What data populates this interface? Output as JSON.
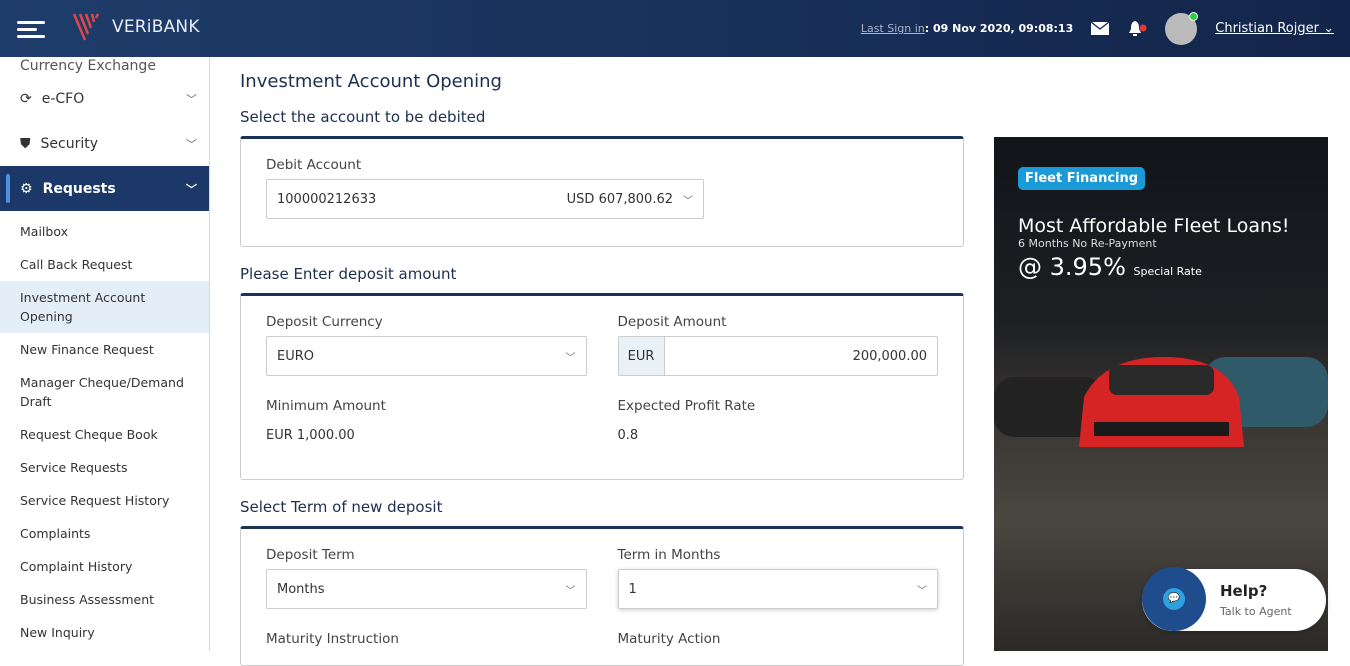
{
  "header": {
    "brand": "VERiBANK",
    "last_signin_label": "Last Sign in",
    "last_signin_value": ": 09 Nov 2020, 09:08:13",
    "user_name": "Christian Rojger"
  },
  "sidebar": {
    "cut_item": "Currency Exchange",
    "main": [
      {
        "label": "e-CFO"
      },
      {
        "label": "Security"
      },
      {
        "label": "Requests"
      }
    ],
    "sub": [
      "Mailbox",
      "Call Back Request",
      "Investment Account Opening",
      "New Finance Request",
      "Manager Cheque/Demand Draft",
      "Request Cheque Book",
      "Service Requests",
      "Service Request History",
      "Complaints",
      "Complaint History",
      "Business Assessment",
      "New Inquiry"
    ]
  },
  "main": {
    "title": "Investment Account Opening",
    "s1": {
      "heading": "Select the account to be debited",
      "debit_label": "Debit Account",
      "account": "100000212633",
      "balance": "USD 607,800.62"
    },
    "s2": {
      "heading": "Please Enter deposit amount",
      "currency_label": "Deposit Currency",
      "currency": "EURO",
      "amount_label": "Deposit Amount",
      "amount_prefix": "EUR",
      "amount": "200,000.00",
      "min_label": "Minimum Amount",
      "min_value": "EUR 1,000.00",
      "rate_label": "Expected Profit Rate",
      "rate_value": "0.8"
    },
    "s3": {
      "heading": "Select Term of new deposit",
      "term_label": "Deposit Term",
      "term": "Months",
      "months_label": "Term in Months",
      "months": "1",
      "maturity_instr_label": "Maturity Instruction",
      "maturity_action_label": "Maturity Action"
    }
  },
  "ad": {
    "badge": "Fleet Financing",
    "title": "Most Affordable Fleet Loans!",
    "subtitle": "6 Months No Re-Payment",
    "rate": "@ 3.95%",
    "rate_note": "Special Rate"
  },
  "help": {
    "title": "Help?",
    "subtitle": "Talk to Agent"
  }
}
